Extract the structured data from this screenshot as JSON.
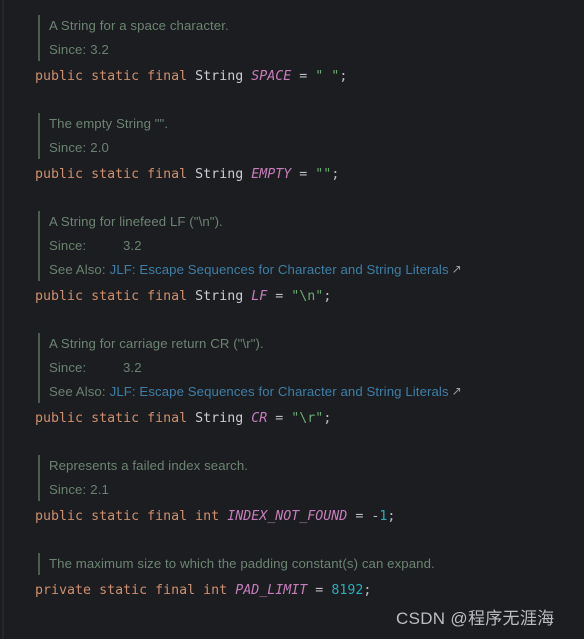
{
  "editor": {
    "language": "java",
    "theme": "dark",
    "background_color": "#1c1d20"
  },
  "colors": {
    "keyword": "#cf8e6d",
    "type": "#c9ccd1",
    "constant": "#c77dbb",
    "operator": "#bcbec4",
    "string": "#6aab73",
    "number": "#2aacb8",
    "doc_text": "#6a8270",
    "doc_bar": "#4c5e4e",
    "link": "#3d7fa8"
  },
  "blocks": [
    {
      "doc": {
        "summary": "A String for a space character.",
        "tags": [
          {
            "name": "Since:",
            "value": "3.2",
            "wide": false
          }
        ]
      },
      "code": {
        "tokens": [
          {
            "t": "public",
            "c": "kw"
          },
          {
            "t": " ",
            "c": "op"
          },
          {
            "t": "static",
            "c": "kw"
          },
          {
            "t": " ",
            "c": "op"
          },
          {
            "t": "final",
            "c": "kw"
          },
          {
            "t": " ",
            "c": "op"
          },
          {
            "t": "String",
            "c": "type"
          },
          {
            "t": " ",
            "c": "op"
          },
          {
            "t": "SPACE",
            "c": "cnst"
          },
          {
            "t": " = ",
            "c": "op"
          },
          {
            "t": "\" \"",
            "c": "str"
          },
          {
            "t": ";",
            "c": "op"
          }
        ]
      }
    },
    {
      "doc": {
        "summary": "The empty String \"\".",
        "tags": [
          {
            "name": "Since:",
            "value": "2.0",
            "wide": false
          }
        ]
      },
      "code": {
        "tokens": [
          {
            "t": "public",
            "c": "kw"
          },
          {
            "t": " ",
            "c": "op"
          },
          {
            "t": "static",
            "c": "kw"
          },
          {
            "t": " ",
            "c": "op"
          },
          {
            "t": "final",
            "c": "kw"
          },
          {
            "t": " ",
            "c": "op"
          },
          {
            "t": "String",
            "c": "type"
          },
          {
            "t": " ",
            "c": "op"
          },
          {
            "t": "EMPTY",
            "c": "cnst"
          },
          {
            "t": " = ",
            "c": "op"
          },
          {
            "t": "\"\"",
            "c": "str"
          },
          {
            "t": ";",
            "c": "op"
          }
        ]
      }
    },
    {
      "doc": {
        "summary": "A String for linefeed LF (\"\\n\").",
        "tags": [
          {
            "name": "Since:",
            "value": "3.2",
            "wide": true
          },
          {
            "name": "See Also:",
            "link": "JLF: Escape Sequences for Character and String Literals",
            "link_icon": "external-link-icon",
            "wide": false
          }
        ]
      },
      "code": {
        "tokens": [
          {
            "t": "public",
            "c": "kw"
          },
          {
            "t": " ",
            "c": "op"
          },
          {
            "t": "static",
            "c": "kw"
          },
          {
            "t": " ",
            "c": "op"
          },
          {
            "t": "final",
            "c": "kw"
          },
          {
            "t": " ",
            "c": "op"
          },
          {
            "t": "String",
            "c": "type"
          },
          {
            "t": " ",
            "c": "op"
          },
          {
            "t": "LF",
            "c": "cnst"
          },
          {
            "t": " = ",
            "c": "op"
          },
          {
            "t": "\"\\n\"",
            "c": "str"
          },
          {
            "t": ";",
            "c": "op"
          }
        ]
      }
    },
    {
      "doc": {
        "summary": "A String for carriage return CR (\"\\r\").",
        "tags": [
          {
            "name": "Since:",
            "value": "3.2",
            "wide": true
          },
          {
            "name": "See Also:",
            "link": "JLF: Escape Sequences for Character and String Literals",
            "link_icon": "external-link-icon",
            "wide": false
          }
        ]
      },
      "code": {
        "tokens": [
          {
            "t": "public",
            "c": "kw"
          },
          {
            "t": " ",
            "c": "op"
          },
          {
            "t": "static",
            "c": "kw"
          },
          {
            "t": " ",
            "c": "op"
          },
          {
            "t": "final",
            "c": "kw"
          },
          {
            "t": " ",
            "c": "op"
          },
          {
            "t": "String",
            "c": "type"
          },
          {
            "t": " ",
            "c": "op"
          },
          {
            "t": "CR",
            "c": "cnst"
          },
          {
            "t": " = ",
            "c": "op"
          },
          {
            "t": "\"\\r\"",
            "c": "str"
          },
          {
            "t": ";",
            "c": "op"
          }
        ]
      }
    },
    {
      "doc": {
        "summary": "Represents a failed index search.",
        "tags": [
          {
            "name": "Since:",
            "value": "2.1",
            "wide": false
          }
        ]
      },
      "code": {
        "tokens": [
          {
            "t": "public",
            "c": "kw"
          },
          {
            "t": " ",
            "c": "op"
          },
          {
            "t": "static",
            "c": "kw"
          },
          {
            "t": " ",
            "c": "op"
          },
          {
            "t": "final",
            "c": "kw"
          },
          {
            "t": " ",
            "c": "op"
          },
          {
            "t": "int",
            "c": "kw"
          },
          {
            "t": " ",
            "c": "op"
          },
          {
            "t": "INDEX_NOT_FOUND",
            "c": "cnst"
          },
          {
            "t": " = ",
            "c": "op"
          },
          {
            "t": "-",
            "c": "op"
          },
          {
            "t": "1",
            "c": "num"
          },
          {
            "t": ";",
            "c": "op"
          }
        ]
      }
    },
    {
      "doc": {
        "summary": "The maximum size to which the padding constant(s) can expand.",
        "tags": []
      },
      "code": {
        "tokens": [
          {
            "t": "private",
            "c": "kw"
          },
          {
            "t": " ",
            "c": "op"
          },
          {
            "t": "static",
            "c": "kw"
          },
          {
            "t": " ",
            "c": "op"
          },
          {
            "t": "final",
            "c": "kw"
          },
          {
            "t": " ",
            "c": "op"
          },
          {
            "t": "int",
            "c": "kw"
          },
          {
            "t": " ",
            "c": "op"
          },
          {
            "t": "PAD_LIMIT",
            "c": "cnst"
          },
          {
            "t": " = ",
            "c": "op"
          },
          {
            "t": "8192",
            "c": "num"
          },
          {
            "t": ";",
            "c": "op"
          }
        ]
      }
    }
  ],
  "watermark": {
    "text": "CSDN @程序无涯海"
  }
}
